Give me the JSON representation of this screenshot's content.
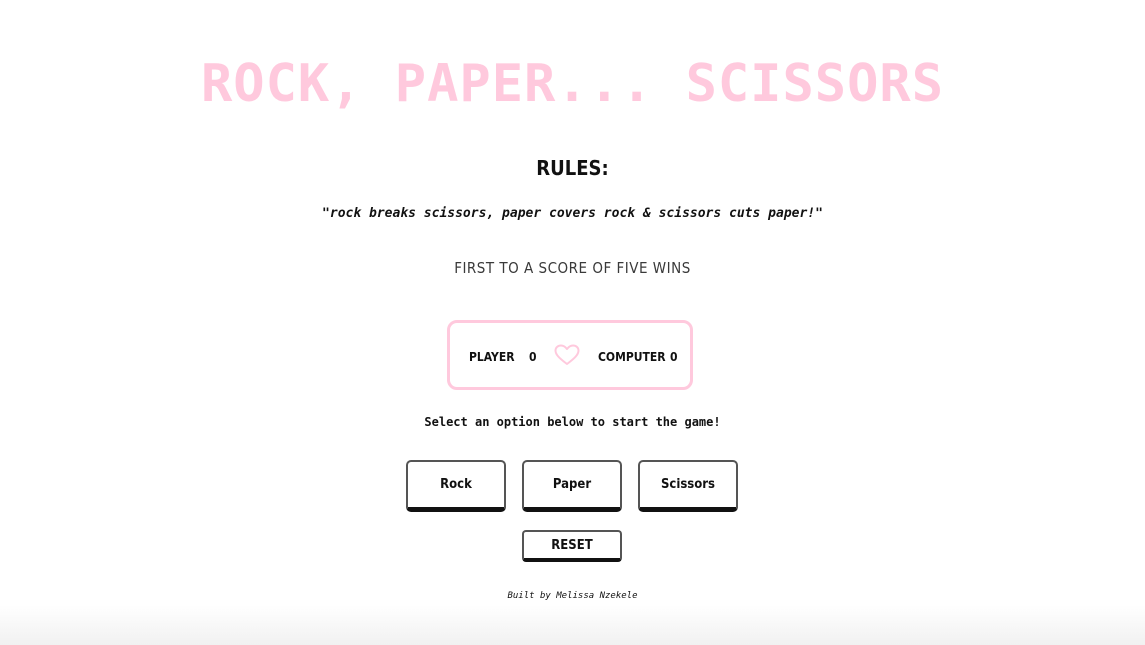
{
  "header": {
    "title": "ROCK, PAPER... SCISSORS"
  },
  "rules": {
    "heading": "RULES:",
    "text": "\"rock breaks scissors, paper covers rock & scissors cuts paper!\"",
    "goal": "FIRST TO A SCORE OF FIVE WINS"
  },
  "scoreboard": {
    "player_label": "PLAYER",
    "player_score": "0",
    "computer_label": "COMPUTER",
    "computer_score": "0",
    "icon": "heart-icon"
  },
  "prompt": "Select an option below to start the game!",
  "choices": {
    "rock": "Rock",
    "paper": "Paper",
    "scissors": "Scissors"
  },
  "reset_label": "RESET",
  "footer": "Built by Melissa Nzekele",
  "colors": {
    "accent_pink": "#ffc9dd",
    "text": "#111111",
    "background": "#ffffff"
  }
}
